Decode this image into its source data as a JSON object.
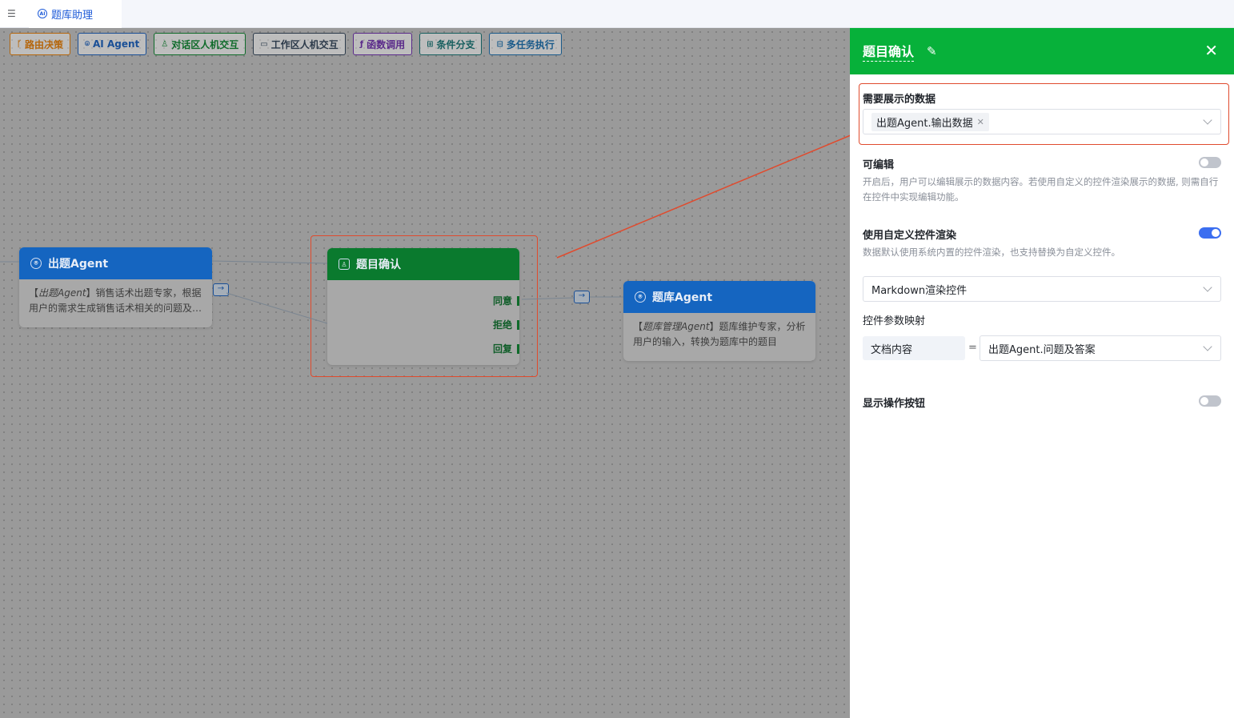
{
  "tab": {
    "label": "题库助理"
  },
  "toolbar": [
    {
      "icon": "branch-icon",
      "label": "路由决策",
      "color": "#b5660c"
    },
    {
      "icon": "agent-icon",
      "label": "AI Agent",
      "color": "#1a4f96"
    },
    {
      "icon": "person-icon",
      "label": "对话区人机交互",
      "color": "#0f6b2a"
    },
    {
      "icon": "monitor-icon",
      "label": "工作区人机交互",
      "color": "#2c3a4a"
    },
    {
      "icon": "function-icon",
      "label": "函数调用",
      "color": "#5a2a8a"
    },
    {
      "icon": "condition-icon",
      "label": "条件分支",
      "color": "#165e5e"
    },
    {
      "icon": "multitask-icon",
      "label": "多任务执行",
      "color": "#1a5a8a"
    }
  ],
  "nodes": {
    "question_agent": {
      "title": "出题Agent",
      "desc_em": "出题Agent",
      "desc_rest_1": "】销售话术出题专家，根据",
      "desc_line2": "用户的需求生成销售话术相关的问题及…"
    },
    "confirm": {
      "title": "题目确认",
      "ports": [
        "同意",
        "拒绝",
        "回复"
      ]
    },
    "bank_agent": {
      "title": "题库Agent",
      "desc_em": "题库管理Agent",
      "desc_rest_1": "】题库维护专家，分析",
      "desc_line2": "用户的输入，转换为题库中的题目"
    }
  },
  "panel": {
    "title": "题目确认",
    "display_data": {
      "label": "需要展示的数据",
      "tag": "出题Agent.输出数据"
    },
    "editable": {
      "label": "可编辑",
      "desc": "开启后，用户可以编辑展示的数据内容。若使用自定义的控件渲染展示的数据, 则需自行在控件中实现编辑功能。",
      "on": false
    },
    "custom_render": {
      "label": "使用自定义控件渲染",
      "desc": "数据默认使用系统内置的控件渲染，也支持替换为自定义控件。",
      "on": true,
      "widget": "Markdown渲染控件"
    },
    "param_map": {
      "label": "控件参数映射",
      "key": "文档内容",
      "eq": "=",
      "value": "出题Agent.问题及答案"
    },
    "show_actions": {
      "label": "显示操作按钮",
      "on": false
    }
  },
  "colors": {
    "panel_header": "#07b13a",
    "agent_header": "#1565c0",
    "confirm_header": "#0a7a2e",
    "highlight": "#e04b2e",
    "toggle_on": "#3b6ef0"
  }
}
